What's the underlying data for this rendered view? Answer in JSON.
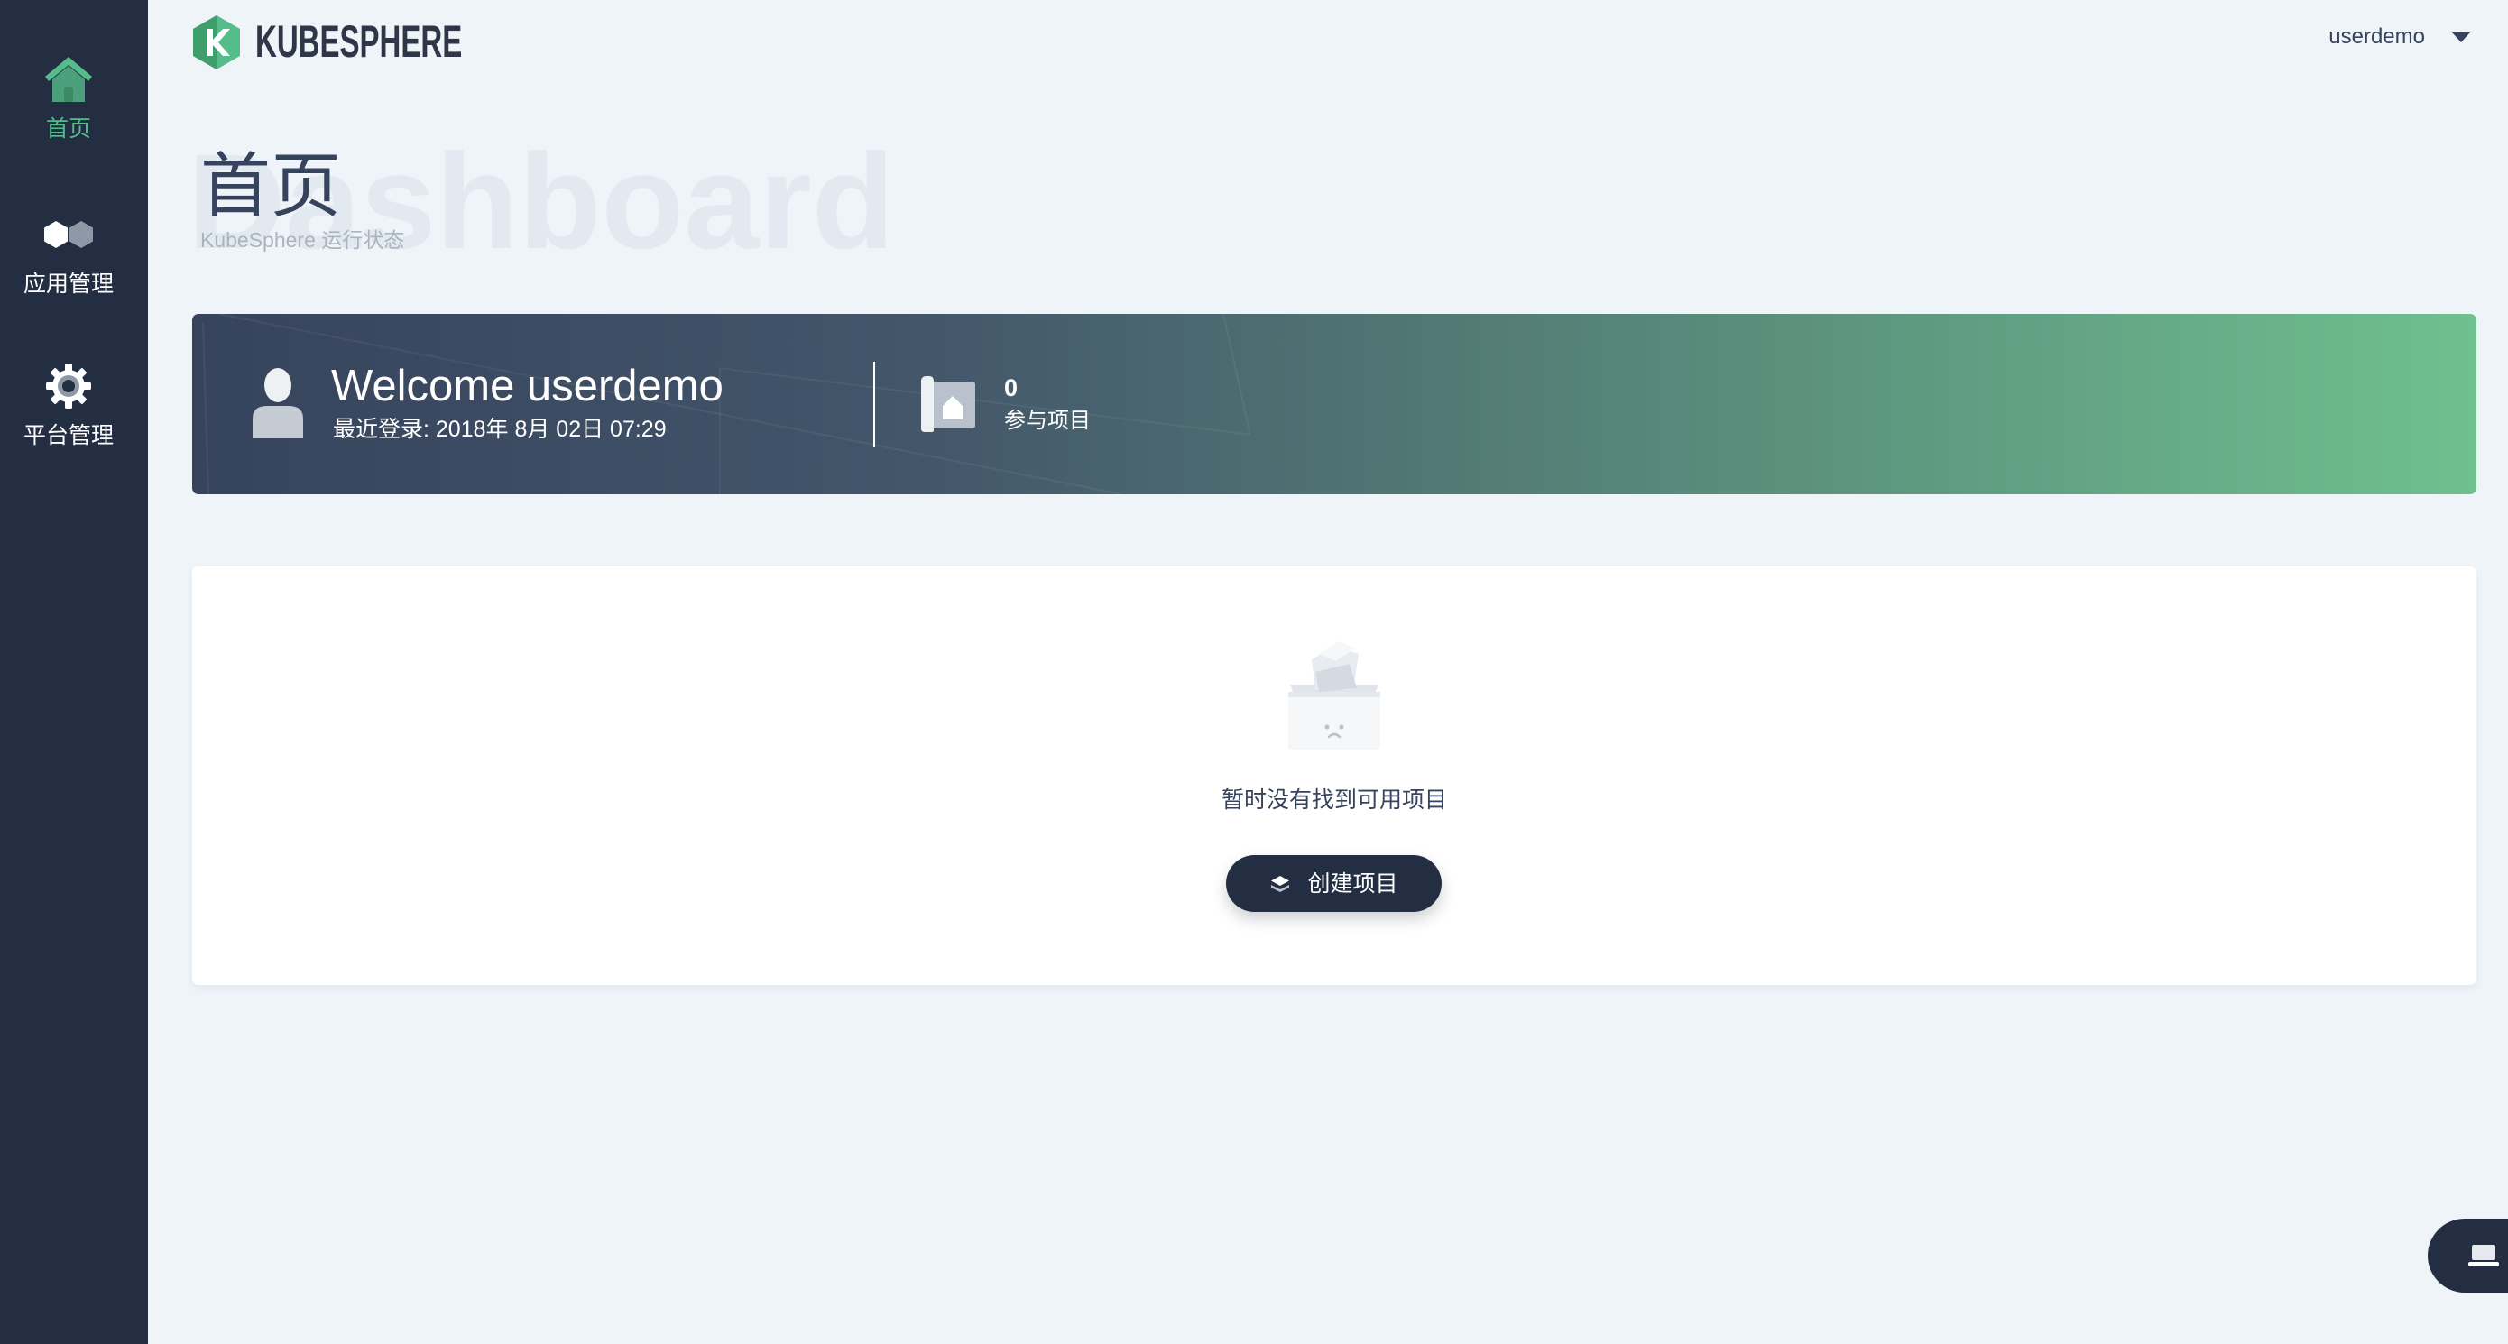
{
  "brand": {
    "name": "KUBESPHERE",
    "logo_icon": "kubesphere-logo-icon"
  },
  "sidebar": {
    "items": [
      {
        "label": "首页",
        "icon": "home-icon",
        "active": true
      },
      {
        "label": "应用管理",
        "icon": "hexagons-icon",
        "active": false
      },
      {
        "label": "平台管理",
        "icon": "gear-icon",
        "active": false
      }
    ]
  },
  "header": {
    "username": "userdemo",
    "menu_icon": "caret-down-icon"
  },
  "page": {
    "title": "首页",
    "watermark": "Dashboard",
    "subtitle": "KubeSphere 运行状态"
  },
  "welcome": {
    "avatar_icon": "user-avatar-icon",
    "greeting": "Welcome userdemo",
    "last_login": "最近登录: 2018年 8月 02日 07:29",
    "stats": [
      {
        "icon": "project-icon",
        "value": "0",
        "label": "参与项目"
      }
    ]
  },
  "empty_state": {
    "illustration": "empty-box-icon",
    "message": "暂时没有找到可用项目",
    "create_button": {
      "label": "创建项目",
      "icon": "layers-icon"
    }
  },
  "floating_button": {
    "icon": "laptop-icon"
  },
  "colors": {
    "sidebar_bg": "#242e42",
    "page_bg": "#eff4f9",
    "accent_green": "#55bc8a",
    "banner_start": "#36435c",
    "banner_end": "#6fc08f",
    "button_bg": "#242e42"
  }
}
